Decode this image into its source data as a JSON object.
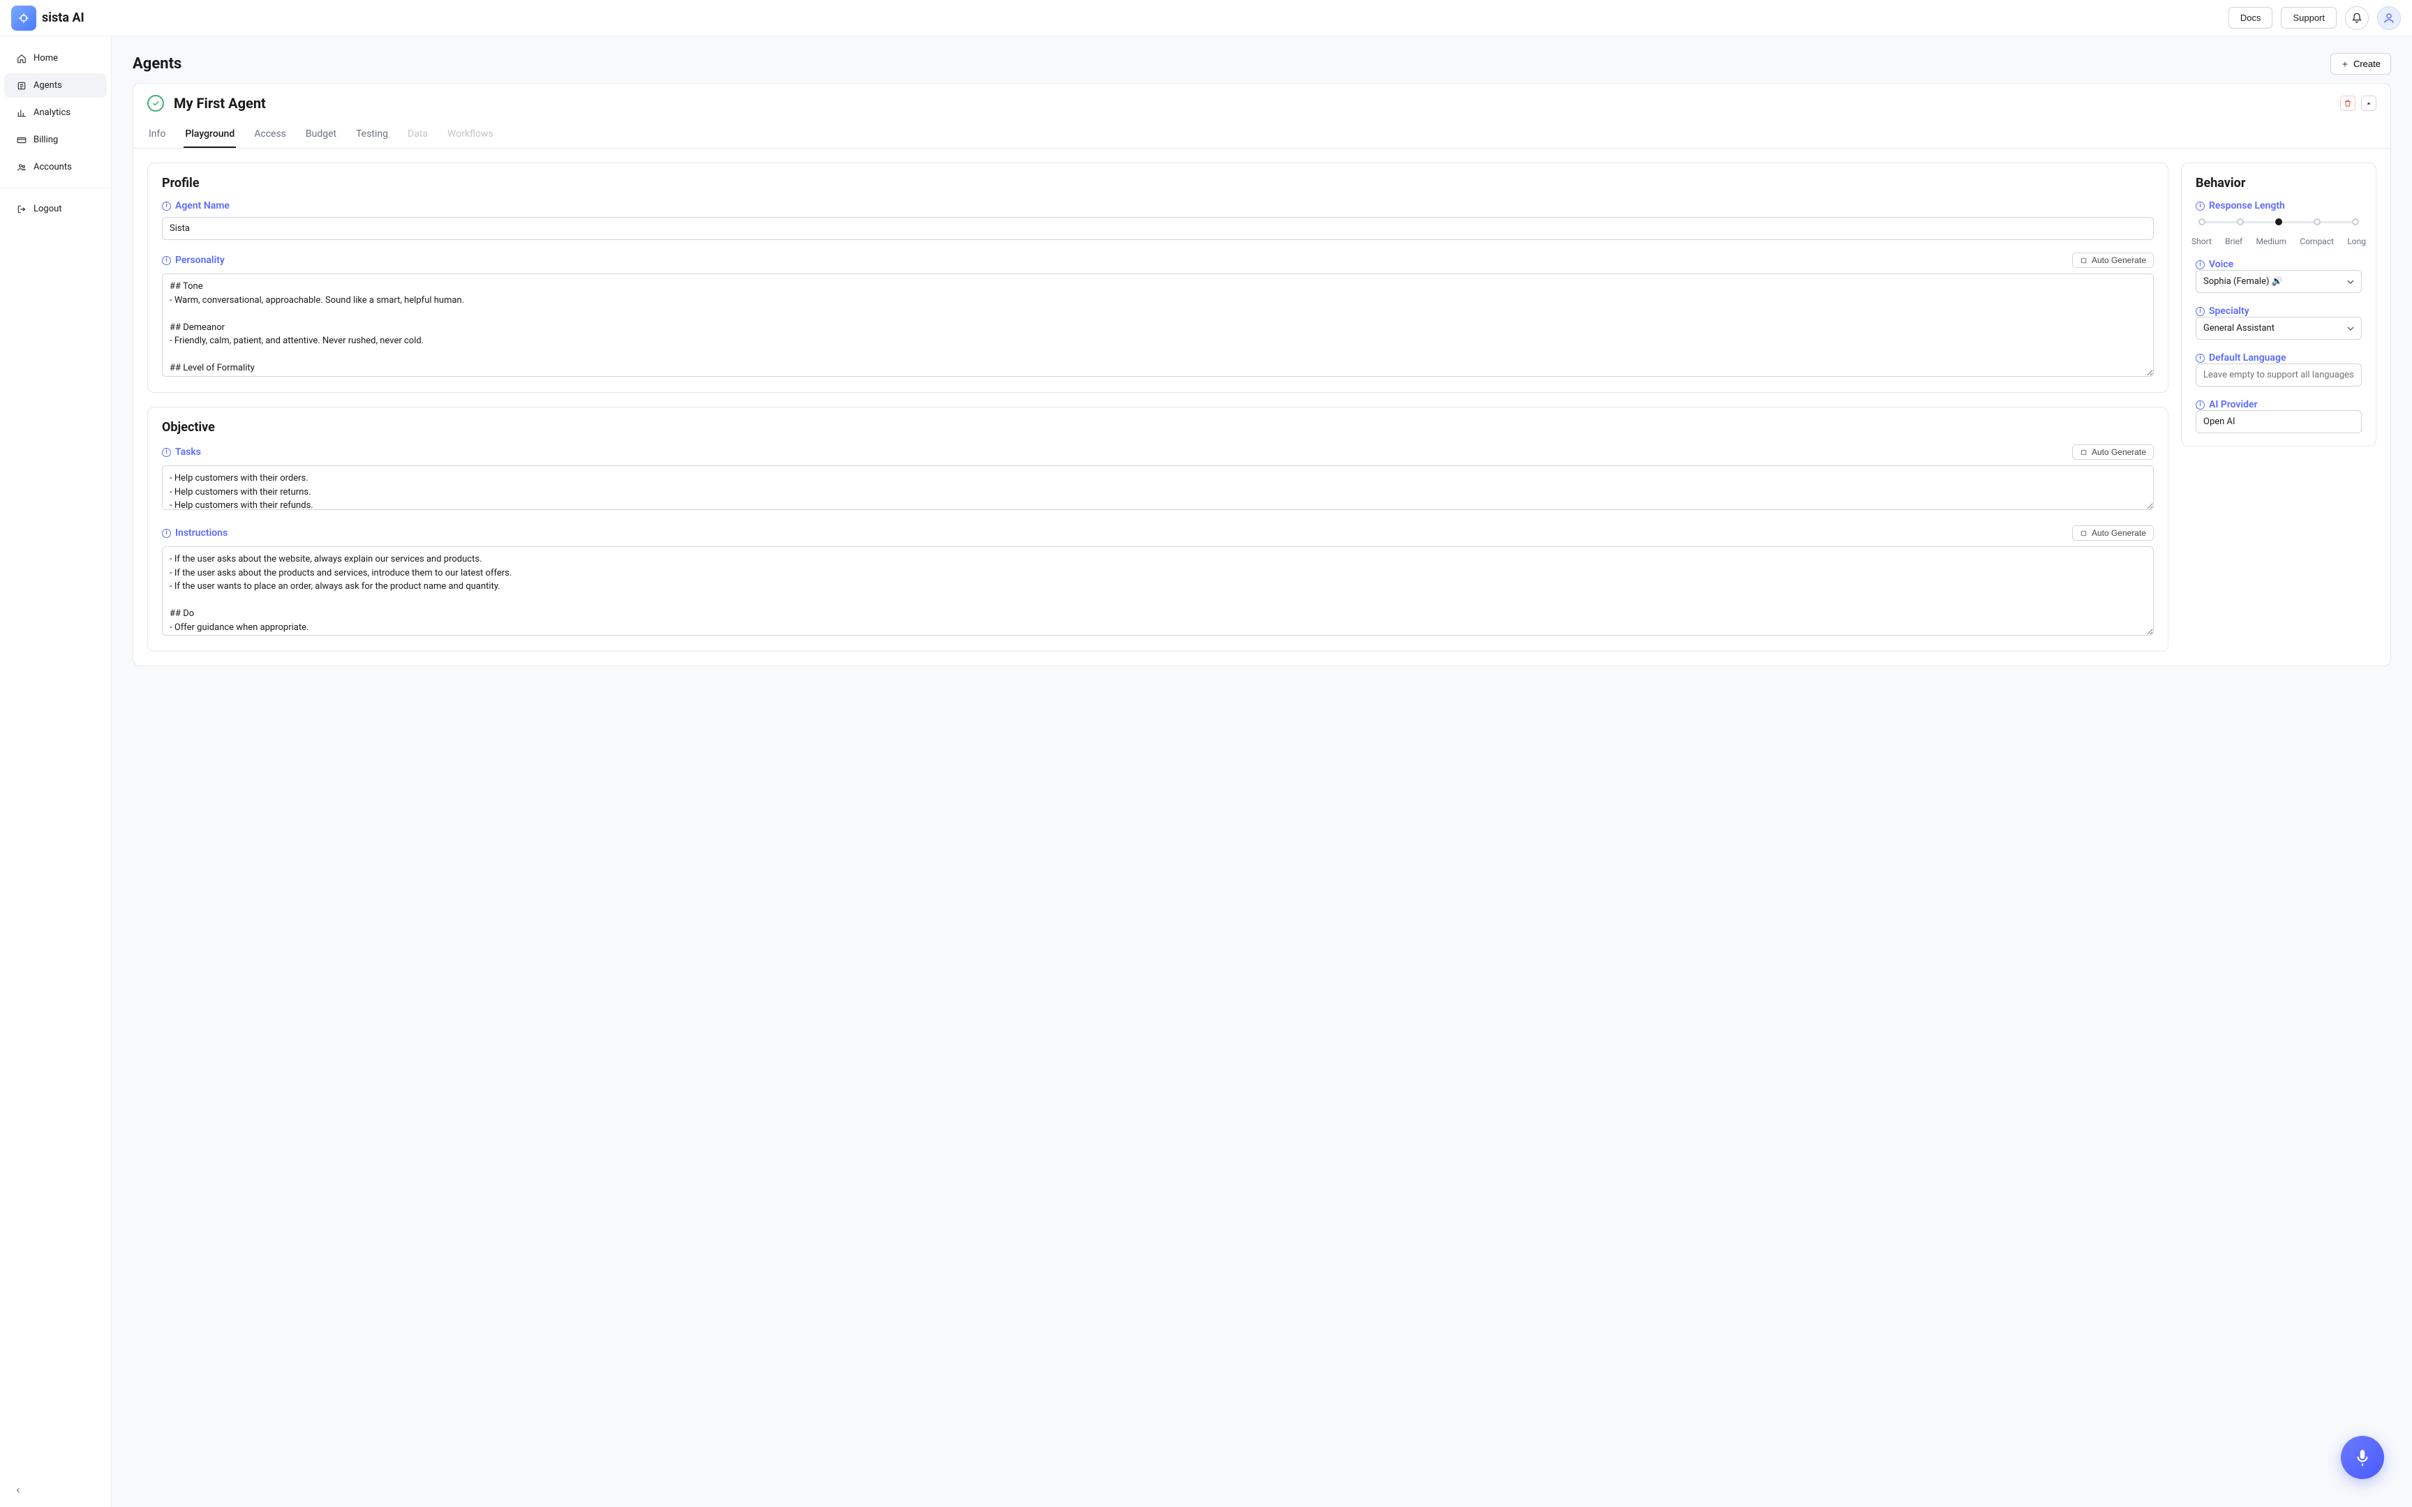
{
  "topbar": {
    "brand": "sista AI",
    "docs": "Docs",
    "support": "Support"
  },
  "sidebar": {
    "items": [
      {
        "label": "Home",
        "icon": "home"
      },
      {
        "label": "Agents",
        "icon": "agents",
        "active": true
      },
      {
        "label": "Analytics",
        "icon": "analytics"
      },
      {
        "label": "Billing",
        "icon": "billing"
      },
      {
        "label": "Accounts",
        "icon": "accounts"
      }
    ],
    "logout": "Logout"
  },
  "page": {
    "title": "Agents",
    "create": "Create"
  },
  "agent": {
    "name": "My First Agent",
    "tabs": [
      "Info",
      "Playground",
      "Access",
      "Budget",
      "Testing",
      "Data",
      "Workflows"
    ],
    "active_tab": "Playground",
    "disabled_tabs": [
      "Data",
      "Workflows"
    ]
  },
  "profile": {
    "title": "Profile",
    "agent_name_label": "Agent Name",
    "agent_name_value": "Sista",
    "personality_label": "Personality",
    "personality_value": "## Tone\n- Warm, conversational, approachable. Sound like a smart, helpful human.\n\n## Demeanor\n- Friendly, calm, patient, and attentive. Never rushed, never cold.\n\n## Level of Formality\n- Casual-professional. Say things like \"Hey! What can I help you with today?\" or \"Gotcha — let me walk you through that.\"",
    "auto_generate": "Auto Generate"
  },
  "objective": {
    "title": "Objective",
    "tasks_label": "Tasks",
    "tasks_value": "- Help customers with their orders.\n- Help customers with their returns.\n- Help customers with their refunds.",
    "instructions_label": "Instructions",
    "instructions_value": "- If the user asks about the website, always explain our services and products.\n- If the user asks about the products and services, introduce them to our latest offers.\n- If the user wants to place an order, always ask for the product name and quantity.\n\n## Do\n- Offer guidance when appropriate.\n- Respond like you're part of the team behind the site.",
    "auto_generate": "Auto Generate"
  },
  "behavior": {
    "title": "Behavior",
    "response_length_label": "Response Length",
    "response_length_options": [
      "Short",
      "Brief",
      "Medium",
      "Compact",
      "Long"
    ],
    "response_length_selected": "Medium",
    "voice_label": "Voice",
    "voice_value": "Sophia (Female) 🔊",
    "specialty_label": "Specialty",
    "specialty_value": "General Assistant",
    "default_language_label": "Default Language",
    "default_language_placeholder": "Leave empty to support all languages",
    "default_language_value": "",
    "ai_provider_label": "AI Provider",
    "ai_provider_value": "Open AI"
  },
  "colors": {
    "accent": "#5b6bff",
    "success": "#3bb273",
    "danger": "#e5484d"
  }
}
